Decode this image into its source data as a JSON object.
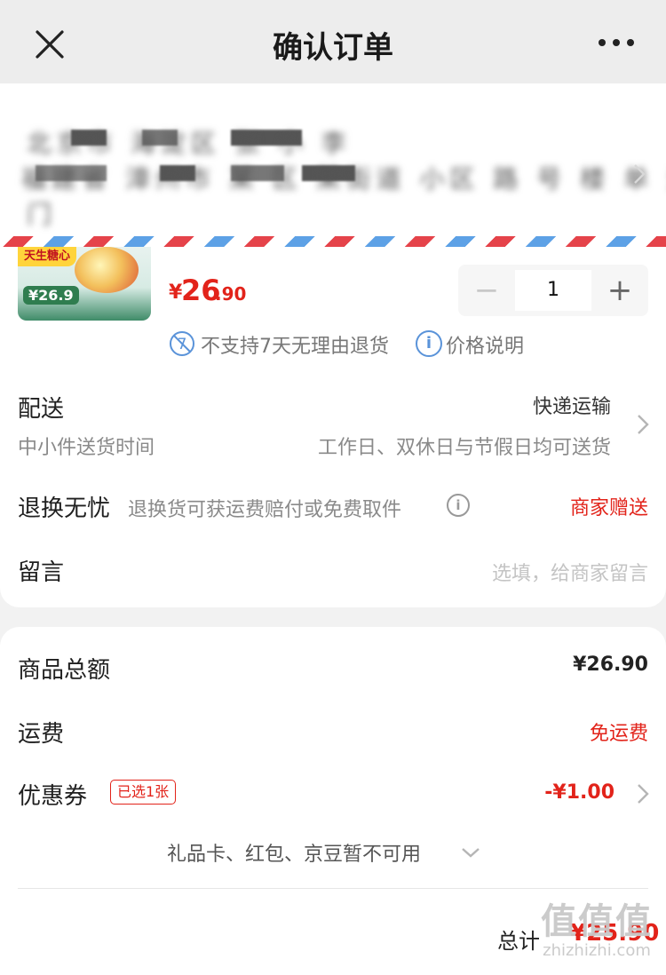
{
  "nav": {
    "title": "确认订单"
  },
  "address": {
    "line1": "北京市 海淀区 张 小 李",
    "line2": "福建省 漳州市 某 区 某街道 小区 路 号 楼 单 元",
    "line3": "门"
  },
  "product": {
    "image_tag": "天生糖心",
    "image_price": "¥26.9",
    "price": {
      "yen": "¥",
      "integer": "26",
      "decimal": ".90"
    },
    "quantity": "1",
    "no_return_text": "不支持7天无理由退货",
    "price_info_text": "价格说明"
  },
  "delivery": {
    "label": "配送",
    "sub": "中小件送货时间",
    "method": "快递运输",
    "schedule": "工作日、双休日与节假日均可送货"
  },
  "returns": {
    "label": "退换无忧",
    "desc": "退换货可获运费赔付或免费取件",
    "value": "商家赠送"
  },
  "message": {
    "label": "留言",
    "placeholder": "选填，给商家留言"
  },
  "summary": {
    "goods_total_label": "商品总额",
    "goods_total_value": "¥26.90",
    "shipping_label": "运费",
    "shipping_value": "免运费",
    "coupon_label": "优惠券",
    "coupon_badge": "已选1张",
    "coupon_value": "-¥1.00",
    "giftcards_text": "礼品卡、红包、京豆暂不可用",
    "total_label": "总计",
    "total_value": "¥25.90"
  },
  "watermark": {
    "logo": "值值值",
    "url": "zhizhizhi.com"
  },
  "colors": {
    "accent_red": "#e2231a",
    "info_blue": "#5a93d9",
    "background": "#f2f2f2"
  }
}
